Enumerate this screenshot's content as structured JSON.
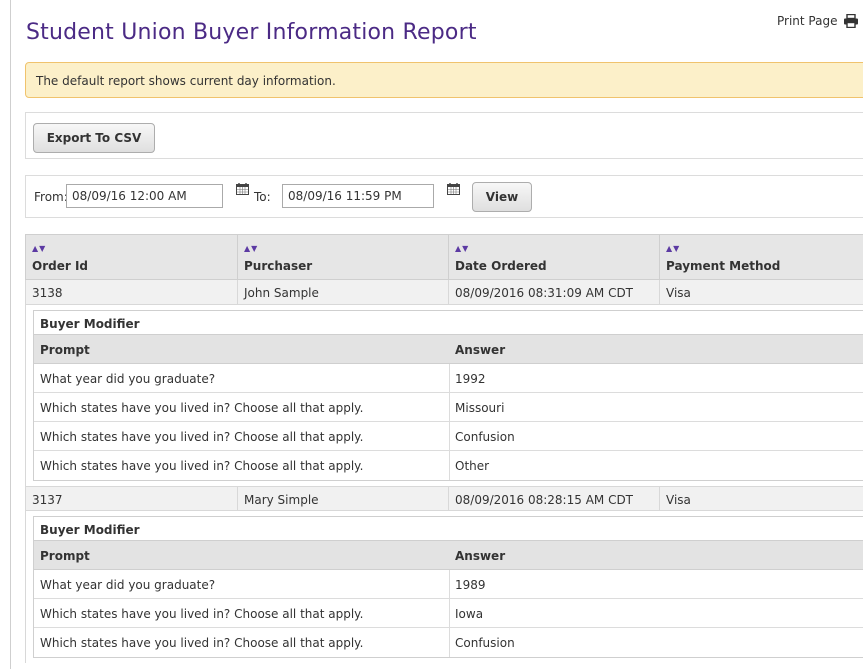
{
  "page": {
    "title": "Student Union Buyer Information Report",
    "print_label": "Print Page",
    "notice": "The default report shows current day information."
  },
  "toolbar": {
    "export_label": "Export To CSV"
  },
  "filter": {
    "from_label": "From:",
    "from_value": "08/09/16 12:00 AM",
    "to_label": "To:",
    "to_value": "08/09/16 11:59 PM",
    "view_label": "View"
  },
  "table": {
    "columns": [
      "Order Id",
      "Purchaser",
      "Date Ordered",
      "Payment Method"
    ],
    "orders": [
      {
        "order_id": "3138",
        "purchaser": "John Sample",
        "date": "08/09/2016 08:31:09 AM CDT",
        "payment": "Visa",
        "modifier": {
          "title": "Buyer Modifier",
          "prompt_header": "Prompt",
          "answer_header": "Answer",
          "rows": [
            {
              "prompt": "What year did you graduate?",
              "answer": "1992"
            },
            {
              "prompt": "Which states have you lived in? Choose all that apply.",
              "answer": "Missouri"
            },
            {
              "prompt": "Which states have you lived in? Choose all that apply.",
              "answer": "Confusion"
            },
            {
              "prompt": "Which states have you lived in? Choose all that apply.",
              "answer": "Other"
            }
          ]
        }
      },
      {
        "order_id": "3137",
        "purchaser": "Mary Simple",
        "date": "08/09/2016 08:28:15 AM CDT",
        "payment": "Visa",
        "modifier": {
          "title": "Buyer Modifier",
          "prompt_header": "Prompt",
          "answer_header": "Answer",
          "rows": [
            {
              "prompt": "What year did you graduate?",
              "answer": "1989"
            },
            {
              "prompt": "Which states have you lived in? Choose all that apply.",
              "answer": "Iowa"
            },
            {
              "prompt": "Which states have you lived in? Choose all that apply.",
              "answer": "Confusion"
            }
          ]
        }
      }
    ]
  }
}
